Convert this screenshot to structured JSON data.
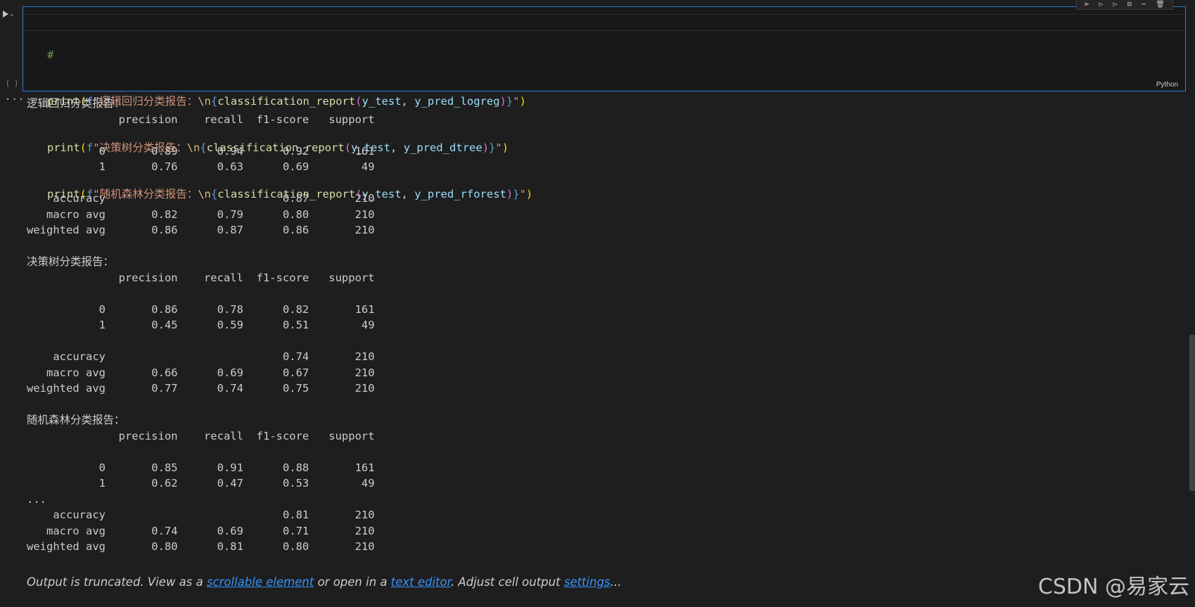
{
  "cell": {
    "language": "Python",
    "exec_count": "[ ]",
    "code_lines": [
      {
        "comment": "#"
      },
      {
        "print": "print",
        "f": "f",
        "qopen": "\"",
        "label": "逻辑回归分类报告：",
        "esc": "\\n",
        "fn": "classification_report",
        "arg1": "y_test",
        "arg2": "y_pred_logreg"
      },
      {
        "print": "print",
        "f": "f",
        "qopen": "\"",
        "label": "决策树分类报告：",
        "esc": "\\n",
        "fn": "classification_report",
        "arg1": "y_test",
        "arg2": "y_pred_dtree"
      },
      {
        "print": "print",
        "f": "f",
        "qopen": "\"",
        "label": "随机森林分类报告：",
        "esc": "\\n",
        "fn": "classification_report",
        "arg1": "y_test",
        "arg2": "y_pred_rforest"
      }
    ],
    "toolbar_icons": [
      "run-by-line-icon",
      "execute-above-icon",
      "execute-below-icon",
      "split-cell-icon",
      "more-icon",
      "delete-icon"
    ]
  },
  "gutter": {
    "out_marker": "···"
  },
  "output": {
    "lines": [
      "逻辑回归分类报告：",
      "              precision    recall  f1-score   support",
      "",
      "           0       0.89      0.94      0.92       161",
      "           1       0.76      0.63      0.69        49",
      "",
      "    accuracy                           0.87       210",
      "   macro avg       0.82      0.79      0.80       210",
      "weighted avg       0.86      0.87      0.86       210",
      "",
      "决策树分类报告：",
      "              precision    recall  f1-score   support",
      "",
      "           0       0.86      0.78      0.82       161",
      "           1       0.45      0.59      0.51        49",
      "",
      "    accuracy                           0.74       210",
      "   macro avg       0.66      0.69      0.67       210",
      "weighted avg       0.77      0.74      0.75       210",
      "",
      "随机森林分类报告：",
      "              precision    recall  f1-score   support",
      "",
      "           0       0.85      0.91      0.88       161",
      "           1       0.62      0.47      0.53        49",
      "...",
      "    accuracy                           0.81       210",
      "   macro avg       0.74      0.69      0.71       210",
      "weighted avg       0.80      0.81      0.80       210"
    ],
    "truncated_notice": {
      "prefix": "Output is truncated. View as a ",
      "link1": "scrollable element",
      "middle": " or open in a ",
      "link2": "text editor",
      "middle2": ". Adjust cell output ",
      "link3": "settings",
      "suffix": "..."
    }
  },
  "watermark": "CSDN @易家云"
}
